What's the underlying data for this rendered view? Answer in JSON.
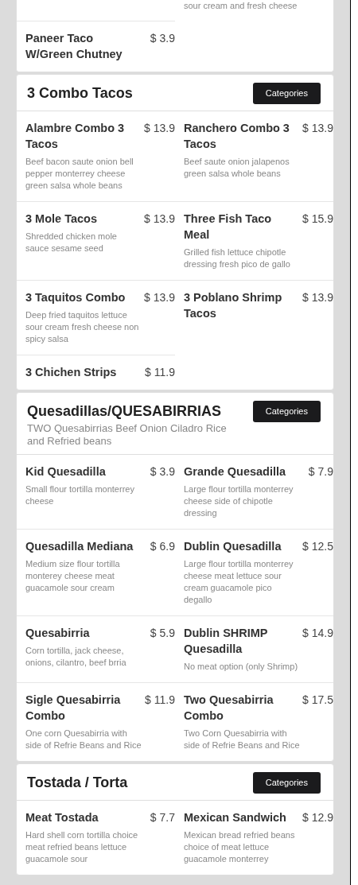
{
  "sections": [
    {
      "cut_top": true,
      "items": [
        {
          "description": "sour cream and fresh cheese"
        },
        {
          "name": "Paneer Taco W/Green Chutney",
          "price": "$ 3.9"
        }
      ]
    },
    {
      "title": "3 Combo Tacos",
      "button": "Categories",
      "items": [
        {
          "name": "Alambre Combo 3 Tacos",
          "price": "$ 13.9",
          "description": "Beef bacon saute onion bell pepper monterrey cheese green salsa whole beans"
        },
        {
          "name": "Ranchero Combo 3 Tacos",
          "price": "$ 13.9",
          "description": "Beef saute onion jalapenos green salsa whole beans"
        },
        {
          "name": "3 Mole Tacos",
          "price": "$ 13.9",
          "description": "Shredded chicken mole sauce sesame seed"
        },
        {
          "name": "Three Fish Taco Meal",
          "price": "$ 15.9",
          "description": "Grilled fish lettuce chipotle dressing fresh pico de gallo"
        },
        {
          "name": "3 Taquitos Combo",
          "price": "$ 13.9",
          "description": "Deep fried taquitos lettuce sour cream fresh cheese non spicy salsa"
        },
        {
          "name": "3 Poblano Shrimp Tacos",
          "price": "$ 13.9"
        },
        {
          "name": "3 Chichen Strips",
          "price": "$ 11.9"
        }
      ]
    },
    {
      "title": "Quesadillas/QUESABIRRIAS",
      "description": "TWO Quesabirrias Beef Onion Ciladro Rice and Refried beans",
      "button": "Categories",
      "items": [
        {
          "name": "Kid Quesadilla",
          "price": "$ 3.9",
          "description": "Small flour tortilla monterrey cheese"
        },
        {
          "name": "Grande Quesadilla",
          "price": "$ 7.9",
          "description": "Large flour tortilla monterrey cheese side of chipotle dressing"
        },
        {
          "name": "Quesadilla Mediana",
          "price": "$ 6.9",
          "description": "Medium size flour tortilla monterey cheese meat guacamole sour cream"
        },
        {
          "name": "Dublin Quesadilla",
          "price": "$ 12.5",
          "description": "Large flour tortilla monterrey cheese meat lettuce sour cream guacamole pico degallo"
        },
        {
          "name": "Quesabirria",
          "price": "$ 5.9",
          "description": "Corn tortilla, jack cheese, onions, cilantro, beef brria"
        },
        {
          "name": "Dublin SHRIMP Quesadilla",
          "price": "$ 14.9",
          "description": "No meat option (only Shrimp)"
        },
        {
          "name": "Sigle Quesabirria Combo",
          "price": "$ 11.9",
          "description": "One corn Quesabirria with side of Refrie Beans and Rice"
        },
        {
          "name": "Two Quesabirria Combo",
          "price": "$ 17.5",
          "description": "Two Corn Quesabirria with side of Refrie Beans and Rice"
        }
      ]
    },
    {
      "title": "Tostada / Torta",
      "button": "Categories",
      "items": [
        {
          "name": "Meat Tostada",
          "price": "$ 7.7",
          "description": "Hard shell corn tortilla choice meat refried beans lettuce guacamole sour"
        },
        {
          "name": "Mexican Sandwich",
          "price": "$ 12.9",
          "description": "Mexican bread refried beans choice of meat lettuce guacamole monterrey"
        }
      ]
    }
  ]
}
